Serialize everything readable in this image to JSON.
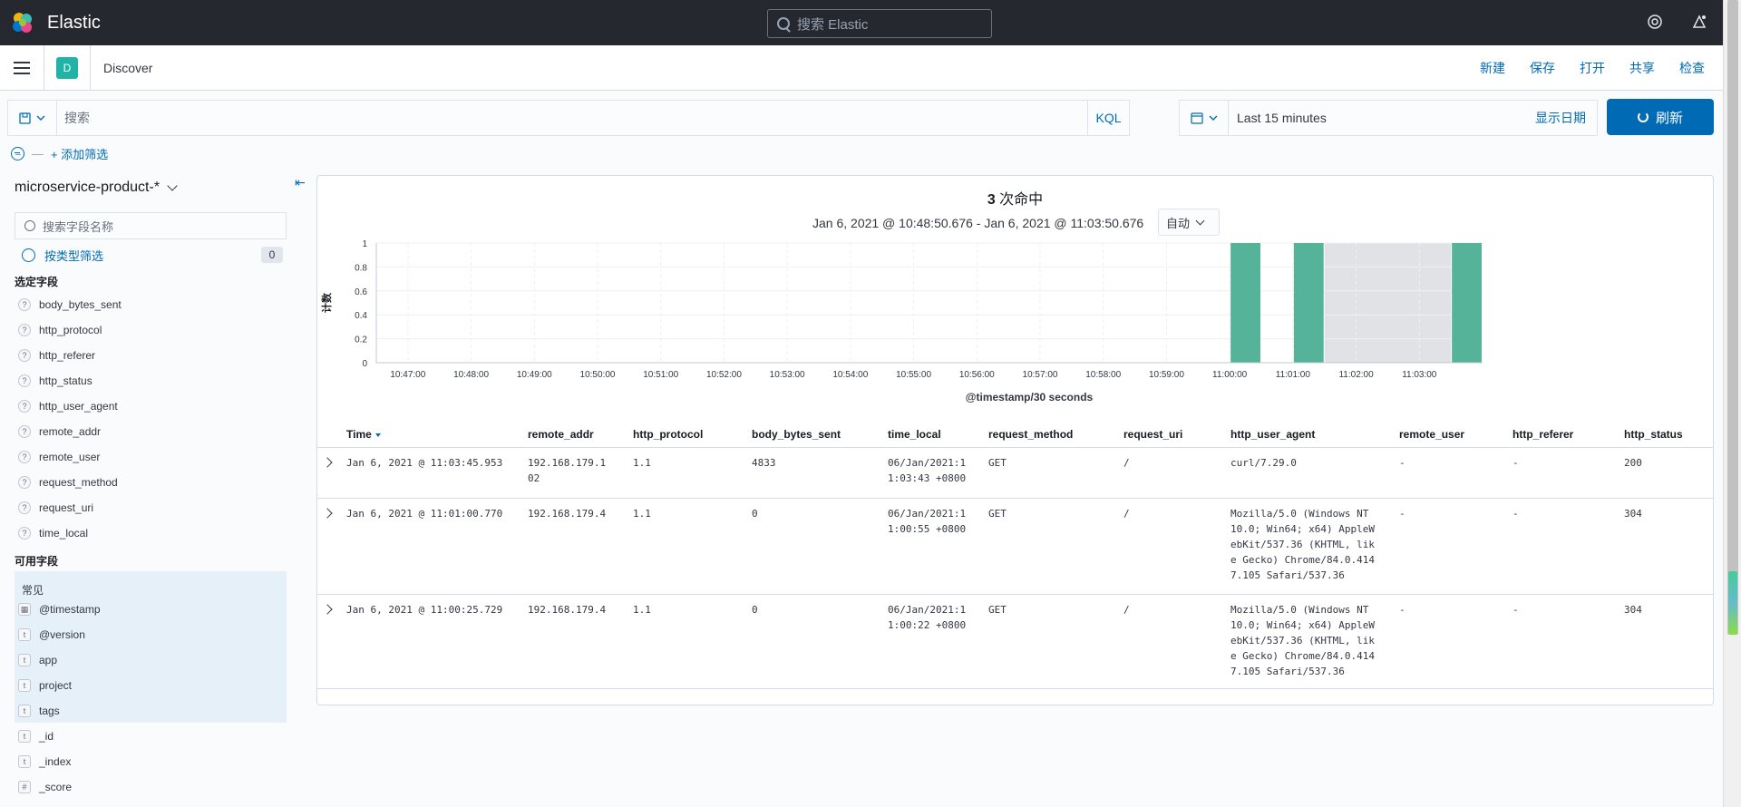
{
  "app": {
    "brand": "Elastic",
    "search_placeholder": "搜索 Elastic"
  },
  "nav": {
    "avatar": "D",
    "crumb": "Discover",
    "links": [
      "新建",
      "保存",
      "打开",
      "共享",
      "检查"
    ]
  },
  "query": {
    "placeholder": "搜索",
    "lang": "KQL",
    "time_range": "Last 15 minutes",
    "show_dates": "显示日期",
    "refresh": "刷新"
  },
  "filters": {
    "add": "+ 添加筛选"
  },
  "sidebar": {
    "index_pattern": "microservice-product-*",
    "field_search_placeholder": "搜索字段名称",
    "type_filter": "按类型筛选",
    "type_filter_count": "0",
    "selected_header": "选定字段",
    "selected_fields": [
      "body_bytes_sent",
      "http_protocol",
      "http_referer",
      "http_status",
      "http_user_agent",
      "remote_addr",
      "remote_user",
      "request_method",
      "request_uri",
      "time_local"
    ],
    "available_header": "可用字段",
    "common_label": "常见",
    "common_fields": [
      {
        "type": "date",
        "name": "@timestamp"
      },
      {
        "type": "t",
        "name": "@version"
      },
      {
        "type": "t",
        "name": "app"
      },
      {
        "type": "t",
        "name": "project"
      },
      {
        "type": "t",
        "name": "tags"
      }
    ],
    "other_fields": [
      {
        "type": "t",
        "name": "_id"
      },
      {
        "type": "t",
        "name": "_index"
      },
      {
        "type": "#",
        "name": "_score"
      }
    ]
  },
  "histogram": {
    "hits": "3",
    "hits_suffix": " 次命中",
    "date_range": "Jan 6, 2021 @ 10:48:50.676 - Jan 6, 2021 @ 11:03:50.676",
    "interval": "自动"
  },
  "chart_data": {
    "type": "bar",
    "ylabel": "计数",
    "xlabel": "@timestamp/30 seconds",
    "ylim": [
      0,
      1
    ],
    "yticks": [
      "0",
      "0.2",
      "0.4",
      "0.6",
      "0.8",
      "1"
    ],
    "xticks": [
      "10:47:00",
      "10:48:00",
      "10:49:00",
      "10:50:00",
      "10:51:00",
      "10:52:00",
      "10:53:00",
      "10:54:00",
      "10:55:00",
      "10:56:00",
      "10:57:00",
      "10:58:00",
      "10:59:00",
      "11:00:00",
      "11:01:00",
      "11:02:00",
      "11:03:00"
    ],
    "bars": [
      {
        "x": "11:00:00",
        "value": 1
      },
      {
        "x": "11:01:00",
        "value": 1
      },
      {
        "x": "11:03:30",
        "value": 1
      }
    ],
    "bar_color": "#54b399",
    "shaded_from": "11:01:30",
    "shaded_to": "11:03:30"
  },
  "table": {
    "columns": [
      "Time",
      "remote_addr",
      "http_protocol",
      "body_bytes_sent",
      "time_local",
      "request_method",
      "request_uri",
      "http_user_agent",
      "remote_user",
      "http_referer",
      "http_status"
    ],
    "rows": [
      [
        "Jan 6, 2021 @ 11:03:45.953",
        "192.168.179.1\n02",
        "1.1",
        "4833",
        "06/Jan/2021:1\n1:03:43 +0800",
        "GET",
        "/",
        "curl/7.29.0",
        "-",
        "-",
        "200"
      ],
      [
        "Jan 6, 2021 @ 11:01:00.770",
        "192.168.179.4",
        "1.1",
        "0",
        "06/Jan/2021:1\n1:00:55 +0800",
        "GET",
        "/",
        "Mozilla/5.0 (Windows NT\n10.0; Win64; x64) AppleW\nebKit/537.36 (KHTML, lik\ne Gecko) Chrome/84.0.414\n7.105 Safari/537.36",
        "-",
        "-",
        "304"
      ],
      [
        "Jan 6, 2021 @ 11:00:25.729",
        "192.168.179.4",
        "1.1",
        "0",
        "06/Jan/2021:1\n1:00:22 +0800",
        "GET",
        "/",
        "Mozilla/5.0 (Windows NT\n10.0; Win64; x64) AppleW\nebKit/537.36 (KHTML, lik\ne Gecko) Chrome/84.0.414\n7.105 Safari/537.36",
        "-",
        "-",
        "304"
      ]
    ]
  }
}
